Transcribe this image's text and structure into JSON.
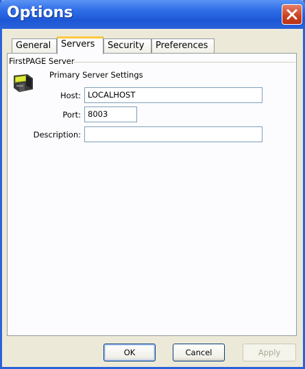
{
  "window": {
    "title": "Options"
  },
  "tabs": [
    {
      "label": "General"
    },
    {
      "label": "Servers"
    },
    {
      "label": "Security"
    },
    {
      "label": "Preferences"
    }
  ],
  "active_tab": "Servers",
  "group": {
    "label": "FirstPAGE Server",
    "section_heading": "Primary Server Settings"
  },
  "fields": {
    "host": {
      "label": "Host:",
      "value": "LOCALHOST"
    },
    "port": {
      "label": "Port:",
      "value": "8003"
    },
    "description": {
      "label": "Description:",
      "value": ""
    }
  },
  "buttons": {
    "ok": "OK",
    "cancel": "Cancel",
    "apply": "Apply"
  },
  "colors": {
    "titlebar": "#2a62d8",
    "active_tab_highlight": "#ffc83c",
    "close_button": "#c9401e"
  },
  "icons": {
    "close": "close-icon",
    "server": "server-icon"
  }
}
